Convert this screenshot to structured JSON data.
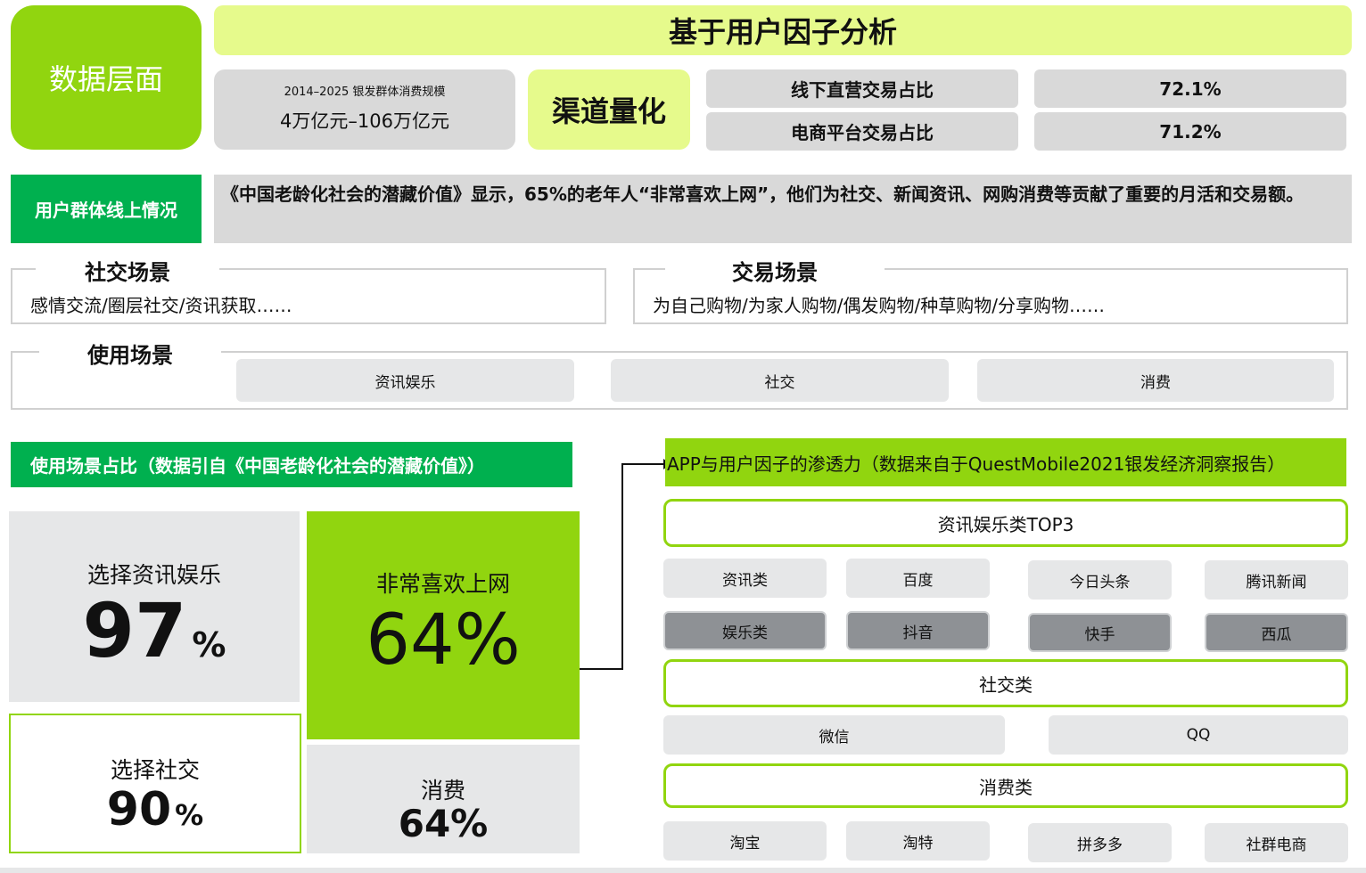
{
  "data_layer": "数据层面",
  "main_title": "基于用户因子分析",
  "consumption": {
    "caption": "2014–2025  银发群体消费规模",
    "value": "4万亿元–106万亿元"
  },
  "channel": {
    "label": "渠道量化",
    "rows": [
      {
        "name": "线下直营交易占比",
        "value": "72.1%"
      },
      {
        "name": "电商平台交易占比",
        "value": "71.2%"
      }
    ]
  },
  "online": {
    "label": "用户群体线上情况",
    "text": "《中国老龄化社会的潜藏价值》显示，65%的老年人“非常喜欢上网”，他们为社交、新闻资讯、网购消费等贡献了重要的月活和交易额。"
  },
  "social_scene": {
    "title": "社交场景",
    "text": "感情交流/圈层社交/资讯获取……"
  },
  "trade_scene": {
    "title": "交易场景",
    "text": "为自己购物/为家人购物/偶发购物/种草购物/分享购物……"
  },
  "usage_scene": {
    "title": "使用场景",
    "items": [
      "资讯娱乐",
      "社交",
      "消费"
    ]
  },
  "usage_ratio": {
    "title": "使用场景占比（数据引自《中国老龄化社会的潜藏价值》）",
    "info": {
      "label": "选择资讯娱乐",
      "value": "97",
      "unit": "%"
    },
    "social": {
      "label": "选择社交",
      "value": "90",
      "unit": "%"
    },
    "love": {
      "label": "非常喜欢上网",
      "value": "64%"
    },
    "consume": {
      "label": "消费",
      "value": "64%"
    }
  },
  "app": {
    "title": "APP与用户因子的渗透力（数据来自于QuestMobile2021银发经济洞察报告）",
    "info_header": "资讯娱乐类TOP3",
    "info_row": [
      "资讯类",
      "百度",
      "今日头条",
      "腾讯新闻"
    ],
    "ent_row": [
      "娱乐类",
      "抖音",
      "快手",
      "西瓜"
    ],
    "social_header": "社交类",
    "social_row": [
      "微信",
      "QQ"
    ],
    "consume_header": "消费类",
    "consume_row": [
      "淘宝",
      "淘特",
      "拼多多",
      "社群电商"
    ]
  },
  "colors": {
    "lime": "#91d50f",
    "pale_lime": "#e6fa8c",
    "green": "#00b04f",
    "grey": "#d9d9d9",
    "dark_grey": "#8e9195"
  }
}
